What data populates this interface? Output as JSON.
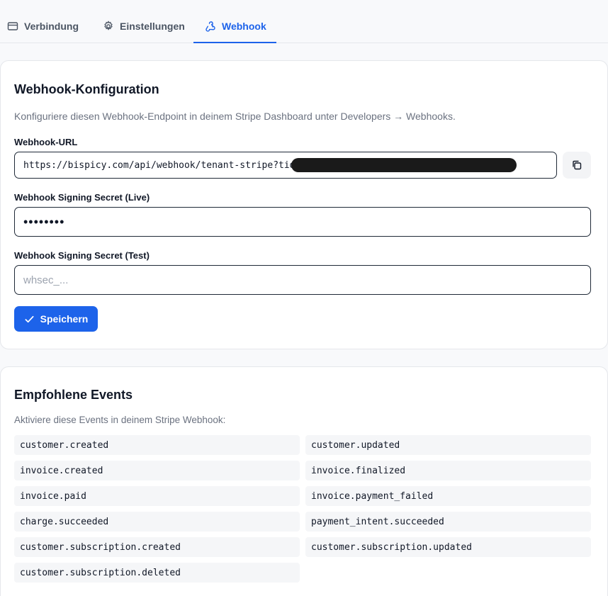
{
  "tabs": [
    {
      "label": "Verbindung",
      "icon": "card-icon",
      "active": false
    },
    {
      "label": "Einstellungen",
      "icon": "gear-icon",
      "active": false
    },
    {
      "label": "Webhook",
      "icon": "webhook-icon",
      "active": true
    }
  ],
  "config": {
    "title": "Webhook-Konfiguration",
    "description": "Konfiguriere diesen Webhook-Endpoint in deinem Stripe Dashboard unter Developers → Webhooks.",
    "url_label": "Webhook-URL",
    "url_value": "https://bispicy.com/api/webhook/tenant-stripe?tid",
    "live_label": "Webhook Signing Secret (Live)",
    "live_value": "••••••••",
    "test_label": "Webhook Signing Secret (Test)",
    "test_placeholder": "whsec_...",
    "save_label": "Speichern"
  },
  "events": {
    "title": "Empfohlene Events",
    "description": "Aktiviere diese Events in deinem Stripe Webhook:",
    "items": [
      "customer.created",
      "customer.updated",
      "invoice.created",
      "invoice.finalized",
      "invoice.paid",
      "invoice.payment_failed",
      "charge.succeeded",
      "payment_intent.succeeded",
      "customer.subscription.created",
      "customer.subscription.updated",
      "customer.subscription.deleted"
    ]
  },
  "colors": {
    "accent": "#1d63ea",
    "muted_text": "#6b7280",
    "event_bg": "#f5f6f8"
  }
}
